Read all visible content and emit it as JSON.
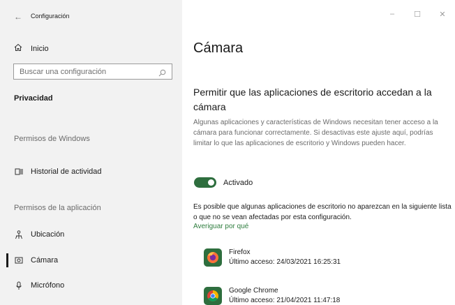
{
  "window": {
    "title": "Configuración",
    "back_glyph": "←",
    "controls": {
      "minimize": "–",
      "maximize": "☐",
      "close": "✕"
    }
  },
  "sidebar": {
    "home_label": "Inicio",
    "search_placeholder": "Buscar una configuración",
    "section_title": "Privacidad",
    "windows_permissions_label": "Permisos de Windows",
    "activity_history_label": "Historial de actividad",
    "app_permissions_label": "Permisos de la aplicación",
    "items": [
      {
        "label": "Ubicación",
        "icon": "location-icon",
        "selected": false
      },
      {
        "label": "Cámara",
        "icon": "camera-icon",
        "selected": true
      },
      {
        "label": "Micrófono",
        "icon": "microphone-icon",
        "selected": false
      }
    ]
  },
  "main": {
    "title": "Cámara",
    "subtitle": "Permitir que las aplicaciones de escritorio accedan a la cámara",
    "description": "Algunas aplicaciones y características de Windows necesitan tener acceso a la cámara para funcionar correctamente. Si desactivas este ajuste aquí, podrías limitar lo que las aplicaciones de escritorio y Windows pueden hacer.",
    "toggle": {
      "label": "Activado",
      "on": true
    },
    "note": "Es posible que algunas aplicaciones de escritorio no aparezcan en la siguiente lista o que no se vean afectadas por esta configuración.",
    "link": "Averiguar por qué",
    "apps": [
      {
        "name": "Firefox",
        "last_access": "Último acceso: 24/03/2021 16:25:31",
        "icon": "firefox-icon"
      },
      {
        "name": "Google Chrome",
        "last_access": "Último acceso: 21/04/2021 11:47:18",
        "icon": "chrome-icon"
      }
    ]
  },
  "colors": {
    "accent": "#2e6e3e",
    "link": "#2e7d3e",
    "sidebar_bg": "#f2f2f2"
  }
}
